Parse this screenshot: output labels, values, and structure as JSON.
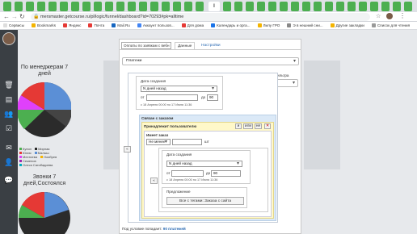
{
  "browser": {
    "active_tab_label": "l",
    "address": "mersmaster.getcourse.ru/pl/logic/funnel/dashboard?id=70293#pk=alltime",
    "bookmarks": [
      "Сервисы",
      "Bookmarks",
      "Яндекс",
      "Почта",
      "Mail.Ru",
      "Аккаунт пользов...",
      "Для дома",
      "Календарь и орга...",
      "Лилу ГРО",
      "Э в нешний сни...",
      "Другие закладки",
      "Список для чтения"
    ]
  },
  "dashboard": {
    "chart1_title": "По менеджерам 7\nдней",
    "chart1_legend": [
      "Купил",
      "Мирная",
      "Юлия",
      "Малыш",
      "Мехтиева",
      "Ноябрев",
      "Семенов",
      "Олеся Сагибадиева"
    ],
    "chart2_title": "Звонки 7\nдней,Состоялся"
  },
  "modal": {
    "report_name": "Оплаты по заявкам с вебн",
    "tab_data": "Данные",
    "tab_settings": "Настройки",
    "source_select": "Платежи",
    "filter_hint": "Поле даты для фильтра",
    "filter_select": "Дата создания",
    "date_block": {
      "title": "Дата создания",
      "mode": "N дней назад",
      "from_label": "от",
      "to_label": "до",
      "to_value": "90",
      "hint": "с 18 Апреля 00:00 по 17 Июля 11:36"
    },
    "link_block": {
      "title": "Связан с заказом",
      "belongs_label": "Принадлежит пользователю",
      "op_and": "и",
      "op_or": "или",
      "op_not": "не",
      "has_order": "Имеет заказ",
      "count_select": "Не менее",
      "count_unit": "шт",
      "collapse_left": "«",
      "inner_date": {
        "title": "Дата создания",
        "mode": "N дней назад",
        "from_label": "от",
        "to_label": "до",
        "to_value": "90",
        "hint": "с 18 Апреля 00:00 по 17 Июля 11:36"
      },
      "offer_title": "Предложение",
      "offer_value": "Все с тегами: Заказа с сайта"
    },
    "footer_prefix": "Под условие попадает:",
    "footer_count": "90 платежей"
  }
}
